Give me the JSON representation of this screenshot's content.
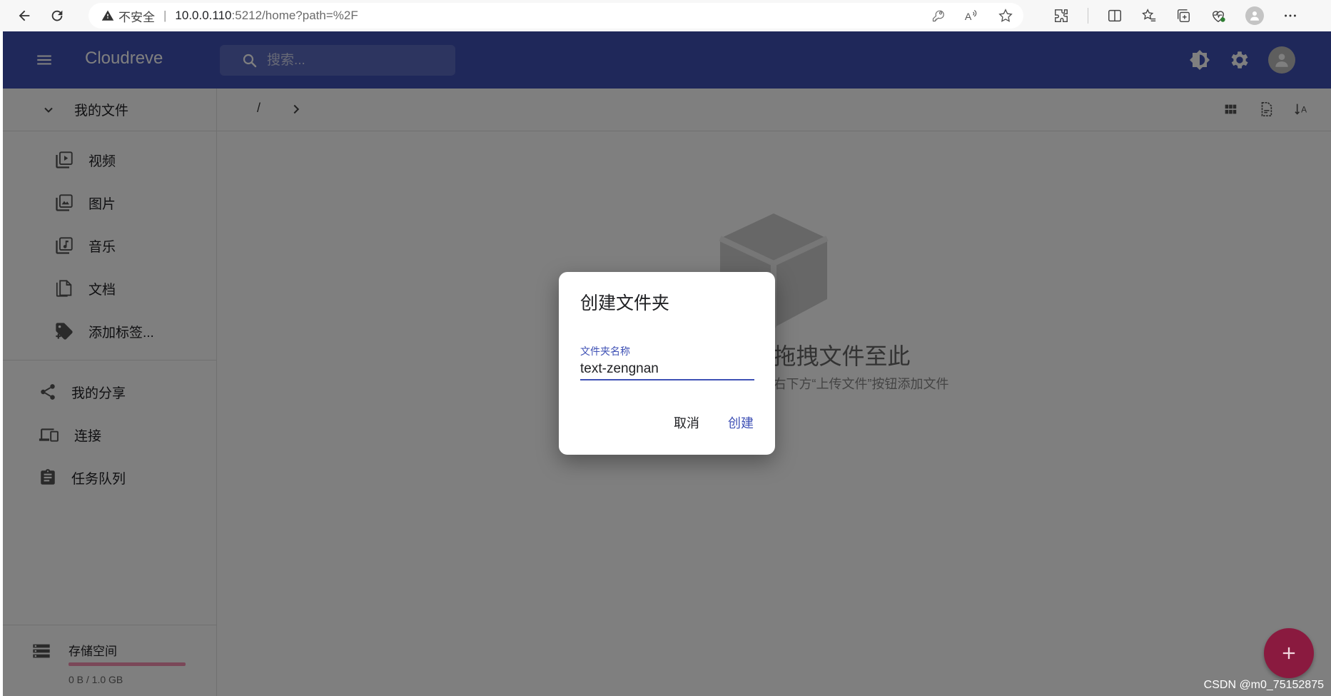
{
  "browser": {
    "security_label": "不安全",
    "separator": "|",
    "url_host": "10.0.0.110",
    "url_path": ":5212/home?path=%2F"
  },
  "appbar": {
    "brand": "Cloudreve",
    "search_placeholder": "搜索..."
  },
  "sidebar": {
    "my_files": "我的文件",
    "sub_items": [
      {
        "label": "视频",
        "icon": "video-library-icon"
      },
      {
        "label": "图片",
        "icon": "photo-library-icon"
      },
      {
        "label": "音乐",
        "icon": "music-library-icon"
      },
      {
        "label": "文档",
        "icon": "document-copy-icon"
      },
      {
        "label": "添加标签...",
        "icon": "add-tag-icon"
      }
    ],
    "top_items": [
      {
        "label": "我的分享",
        "icon": "share-icon"
      },
      {
        "label": "连接",
        "icon": "devices-icon"
      },
      {
        "label": "任务队列",
        "icon": "clipboard-icon"
      }
    ],
    "storage": {
      "title": "存储空间",
      "size": "0 B / 1.0 GB",
      "used_fraction": 0.0
    }
  },
  "main": {
    "breadcrumb_root": "/",
    "empty_title": "拖拽文件至此",
    "empty_subtitle": "或点击右下方“上传文件”按钮添加文件"
  },
  "dialog": {
    "title": "创建文件夹",
    "field_label": "文件夹名称",
    "field_value": "text-zengnan",
    "cancel_label": "取消",
    "create_label": "创建"
  },
  "watermark": "CSDN @m0_75152875",
  "colors": {
    "primary": "#3f51b5",
    "accent": "#e91e63"
  }
}
